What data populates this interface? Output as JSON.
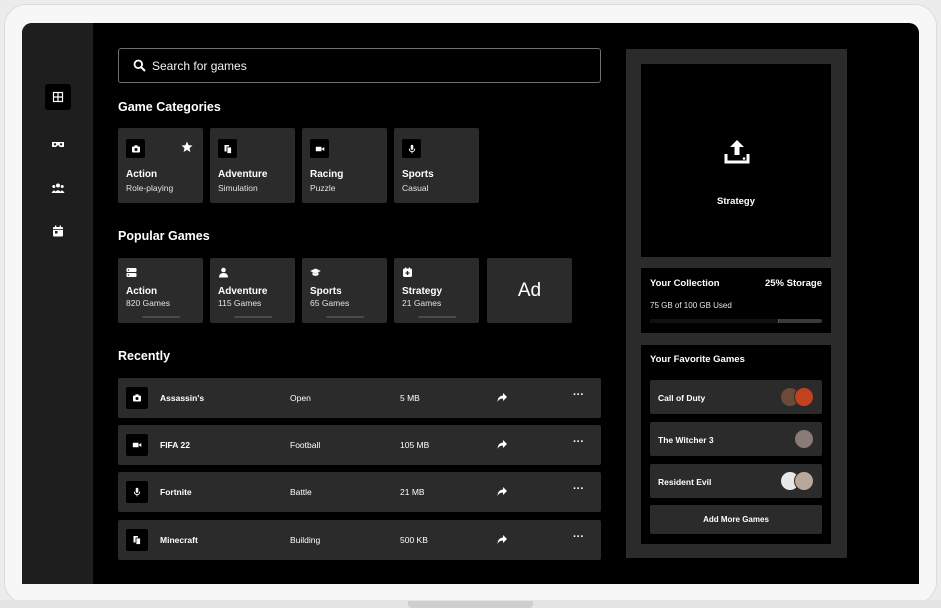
{
  "search": {
    "placeholder": "Search for games",
    "icon": "search-icon"
  },
  "nav": [
    {
      "icon": "grid-icon",
      "active": true
    },
    {
      "icon": "vr-headset-icon",
      "active": false
    },
    {
      "icon": "users-icon",
      "active": false
    },
    {
      "icon": "calendar-icon",
      "active": false
    }
  ],
  "categories": {
    "title": "Game Categories",
    "items": [
      {
        "name": "Action",
        "sub": "Role-playing",
        "icon": "camera-icon",
        "favorite": true
      },
      {
        "name": "Adventure",
        "sub": "Simulation",
        "icon": "copy-icon"
      },
      {
        "name": "Racing",
        "sub": "Puzzle",
        "icon": "video-icon"
      },
      {
        "name": "Sports",
        "sub": "Casual",
        "icon": "microphone-icon"
      }
    ]
  },
  "popular": {
    "title": "Popular Games",
    "items": [
      {
        "name": "Action",
        "count": "820 Games",
        "icon": "server-icon"
      },
      {
        "name": "Adventure",
        "count": "115 Games",
        "icon": "user-icon"
      },
      {
        "name": "Sports",
        "count": "65 Games",
        "icon": "graduation-cap-icon"
      },
      {
        "name": "Strategy",
        "count": "21 Games",
        "icon": "plus-square-icon"
      }
    ],
    "ad_label": "Ad"
  },
  "recently": {
    "title": "Recently",
    "rows": [
      {
        "name": "Assassin's",
        "genre": "Open",
        "size": "5 MB",
        "icon": "camera-icon",
        "more": "···"
      },
      {
        "name": "FIFA 22",
        "genre": "Football",
        "size": "105 MB",
        "icon": "video-icon",
        "more": "···"
      },
      {
        "name": "Fortnite",
        "genre": "Battle",
        "size": "21 MB",
        "icon": "microphone-icon",
        "more": "···"
      },
      {
        "name": "Minecraft",
        "genre": "Building",
        "size": "500 KB",
        "icon": "copy-icon",
        "more": "···"
      }
    ]
  },
  "upload": {
    "label": "Strategy",
    "icon": "upload-icon"
  },
  "collection": {
    "title": "Your Collection",
    "storage_label": "25% Storage",
    "usage": "75 GB of 100 GB Used",
    "used_fraction": 0.75
  },
  "favorites": {
    "title": "Your Favorite Games",
    "items": [
      {
        "name": "Call of Duty",
        "avatars": [
          "#6b4a3a",
          "#c2421f"
        ]
      },
      {
        "name": "The Witcher 3",
        "avatars": [
          "#8a7a78"
        ]
      },
      {
        "name": "Resident Evil",
        "avatars": [
          "#e8e8e8",
          "#b9a89a"
        ]
      }
    ],
    "add_label": "Add More Games"
  }
}
